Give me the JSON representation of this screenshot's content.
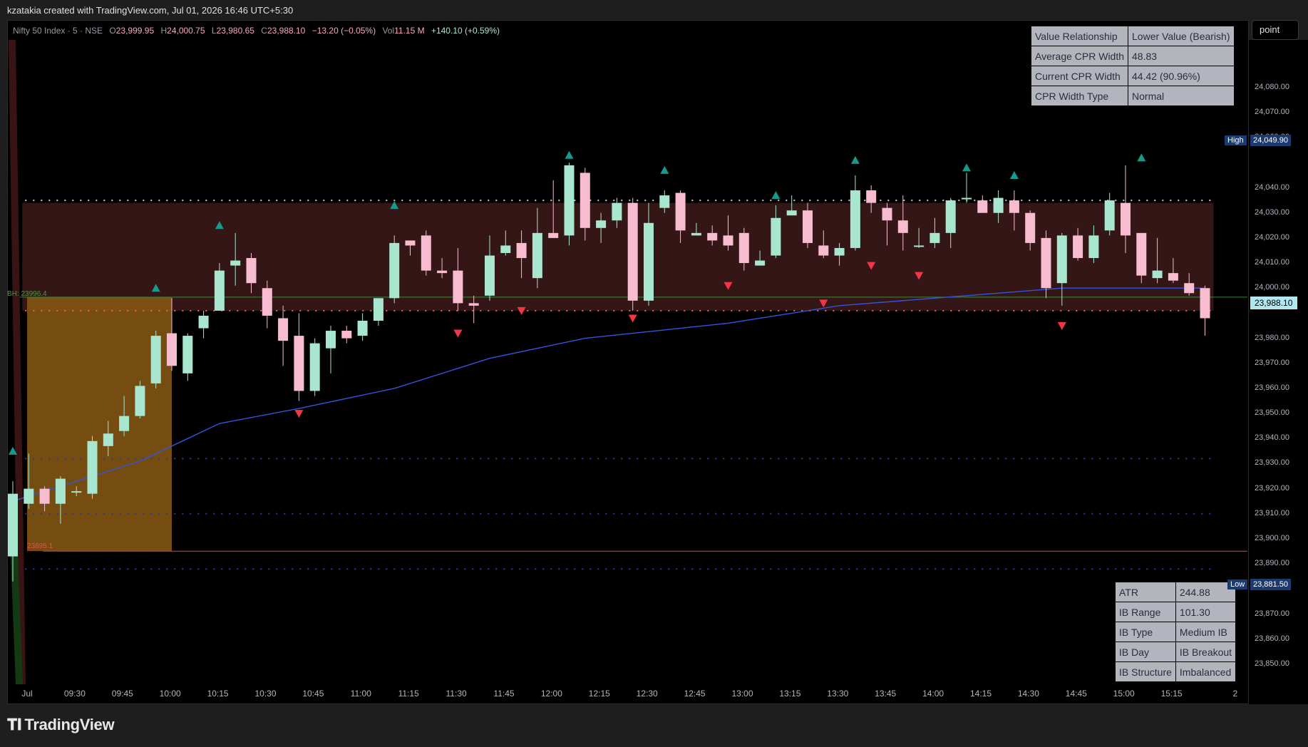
{
  "header": {
    "credit": "kzatakia created with TradingView.com, Jul 01, 2026 16:46 UTC+5:30"
  },
  "legend": {
    "symbol": "Nifty 50 Index · 5 · NSE",
    "o_label": "O",
    "o_val": "23,999.95",
    "h_label": "H",
    "h_val": "24,000.75",
    "l_label": "L",
    "l_val": "23,980.65",
    "c_label": "C",
    "c_val": "23,988.10",
    "change": "−13.20 (−0.05%)",
    "vol_label": "Vol",
    "vol_val": "11.15 M",
    "ext": "+140.10 (+0.59%)"
  },
  "toolbar": {
    "point_label": "point"
  },
  "cpr_table": [
    [
      "Value Relationship",
      "Lower Value (Bearish)"
    ],
    [
      "Average CPR Width",
      "48.83"
    ],
    [
      "Current CPR Width",
      "44.42 (90.96%)"
    ],
    [
      "CPR Width Type",
      "Normal"
    ]
  ],
  "ib_table": [
    [
      "ATR",
      "244.88"
    ],
    [
      "IB Range",
      "101.30"
    ],
    [
      "IB Type",
      "Medium IB"
    ],
    [
      "IB Day",
      "IB Breakout"
    ],
    [
      "IB Structure",
      "Imbalanced"
    ]
  ],
  "price_axis": {
    "ticks": [
      "24,080.00",
      "24,070.00",
      "24,060.00",
      "24,040.00",
      "24,030.00",
      "24,020.00",
      "24,010.00",
      "24,000.00",
      "23,980.00",
      "23,970.00",
      "23,960.00",
      "23,950.00",
      "23,940.00",
      "23,930.00",
      "23,920.00",
      "23,910.00",
      "23,900.00",
      "23,890.00",
      "23,870.00",
      "23,860.00",
      "23,850.00"
    ],
    "tick_values": [
      24080,
      24070,
      24060,
      24040,
      24030,
      24020,
      24010,
      24000,
      23980,
      23970,
      23960,
      23950,
      23940,
      23930,
      23920,
      23910,
      23900,
      23890,
      23870,
      23860,
      23850
    ],
    "high_label": "High",
    "high_value": "24,049.90",
    "low_label": "Low",
    "low_value": "23,881.50",
    "current_price": "23,988.10",
    "bh_label": "BH: 23996.4",
    "ib_low_label": "23895.1"
  },
  "time_axis": {
    "labels": [
      "Jul",
      "09:30",
      "09:45",
      "10:00",
      "10:15",
      "10:30",
      "10:45",
      "11:00",
      "11:15",
      "11:30",
      "11:45",
      "12:00",
      "12:15",
      "12:30",
      "12:45",
      "13:00",
      "13:15",
      "13:30",
      "13:45",
      "14:00",
      "14:15",
      "14:30",
      "14:45",
      "15:00",
      "15:15",
      "2"
    ],
    "label_bar_index": [
      0,
      3,
      6,
      9,
      12,
      15,
      18,
      21,
      24,
      27,
      30,
      33,
      36,
      39,
      42,
      45,
      48,
      51,
      54,
      57,
      60,
      63,
      66,
      69,
      72,
      76
    ]
  },
  "footer": {
    "logo_text": "TradingView"
  },
  "colors": {
    "up": "#a8e6cf",
    "down": "#f7bcd0",
    "cpr_band": "#3a1818",
    "ib_box": "#8a5a14",
    "ma": "#3355dd",
    "signal_up": "#159a8c",
    "signal_down": "#f23645"
  },
  "chart_data": {
    "type": "candlestick",
    "title": "Nifty 50 Index · 5 · NSE",
    "ylim": [
      23842,
      24099
    ],
    "candles": [
      [
        23893,
        23918,
        23883,
        23923
      ],
      [
        23914,
        23920,
        23912,
        23934
      ],
      [
        23920,
        23914,
        23911,
        23921
      ],
      [
        23914,
        23924,
        23906,
        23925
      ],
      [
        23919,
        23919,
        23917,
        23921
      ],
      [
        23918,
        23939,
        23916,
        23941
      ],
      [
        23937,
        23942,
        23933,
        23947
      ],
      [
        23943,
        23949,
        23941,
        23957
      ],
      [
        23949,
        23961,
        23948,
        23963
      ],
      [
        23962,
        23981,
        23960,
        23983
      ],
      [
        23982,
        23969,
        23967,
        23996
      ],
      [
        23966,
        23981,
        23963,
        23982
      ],
      [
        23984,
        23989,
        23980,
        23991
      ],
      [
        23991,
        24007,
        23991,
        24010
      ],
      [
        24009,
        24011,
        24001,
        24022
      ],
      [
        24012,
        24002,
        23998,
        24014
      ],
      [
        24000,
        23989,
        23984,
        24003
      ],
      [
        23988,
        23979,
        23969,
        23993
      ],
      [
        23981,
        23959,
        23955,
        23990
      ],
      [
        23959,
        23978,
        23957,
        23980
      ],
      [
        23976,
        23983,
        23966,
        23985
      ],
      [
        23983,
        23980,
        23978,
        23985
      ],
      [
        23981,
        23987,
        23979,
        23990
      ],
      [
        23987,
        23996,
        23985,
        23996
      ],
      [
        23996,
        24018,
        23994,
        24021
      ],
      [
        24019,
        24017,
        24013,
        24019
      ],
      [
        24021,
        24007,
        24005,
        24023
      ],
      [
        24007,
        24006,
        24004,
        24012
      ],
      [
        24007,
        23994,
        23991,
        24016
      ],
      [
        23994,
        23993,
        23986,
        23997
      ],
      [
        23997,
        24013,
        23995,
        24021
      ],
      [
        24014,
        24017,
        24013,
        24023
      ],
      [
        24018,
        24012,
        24004,
        24023
      ],
      [
        24004,
        24022,
        24000,
        24032
      ],
      [
        24022,
        24020,
        24020,
        24043
      ],
      [
        24021,
        24049,
        24017,
        24050
      ],
      [
        24046,
        24024,
        24019,
        24048
      ],
      [
        24024,
        24027,
        24018,
        24030
      ],
      [
        24027,
        24034,
        24024,
        24036
      ],
      [
        24034,
        23995,
        23991,
        24036
      ],
      [
        23995,
        24026,
        23993,
        24034
      ],
      [
        24032,
        24037,
        24030,
        24039
      ],
      [
        24038,
        24023,
        24018,
        24039
      ],
      [
        24021,
        24022,
        24022,
        24026
      ],
      [
        24022,
        24019,
        24017,
        24025
      ],
      [
        24021,
        24017,
        24015,
        24029
      ],
      [
        24022,
        24010,
        24007,
        24024
      ],
      [
        24009,
        24011,
        24009,
        24015
      ],
      [
        24013,
        24028,
        24012,
        24033
      ],
      [
        24029,
        24031,
        24030,
        24037
      ],
      [
        24031,
        24018,
        24016,
        24034
      ],
      [
        24017,
        24013,
        24012,
        24023
      ],
      [
        24013,
        24016,
        24009,
        24018
      ],
      [
        24016,
        24039,
        24015,
        24045
      ],
      [
        24039,
        24034,
        24030,
        24041
      ],
      [
        24032,
        24027,
        24017,
        24034
      ],
      [
        24027,
        24022,
        24015,
        24037
      ],
      [
        24017,
        24017,
        24016,
        24024
      ],
      [
        24018,
        24022,
        24016,
        24028
      ],
      [
        24022,
        24035,
        24016,
        24036
      ],
      [
        24036,
        24036,
        24034,
        24046
      ],
      [
        24035,
        24030,
        24030,
        24037
      ],
      [
        24030,
        24036,
        24026,
        24039
      ],
      [
        24035,
        24030,
        24023,
        24039
      ],
      [
        24030,
        24018,
        24015,
        24031
      ],
      [
        24020,
        24000,
        23996,
        24023
      ],
      [
        24002,
        24021,
        23993,
        24022
      ],
      [
        24021,
        24012,
        24011,
        24024
      ],
      [
        24012,
        24021,
        24010,
        24025
      ],
      [
        24023,
        24035,
        24021,
        24038
      ],
      [
        24034,
        24021,
        24014,
        24049
      ],
      [
        24022,
        24005,
        24002,
        24022
      ],
      [
        24004,
        24007,
        24002,
        24020
      ],
      [
        24006,
        24003,
        24002,
        24012
      ],
      [
        24002,
        23998,
        23997,
        24006
      ],
      [
        24000,
        23988,
        23981,
        24001
      ]
    ],
    "cpr_band": [
      23991,
      24034
    ],
    "ib_box": {
      "from_bar": 0,
      "to_bar": 9,
      "high": 23996.4,
      "low": 23895.1
    },
    "ma_anchor_points": [
      [
        0,
        23915
      ],
      [
        8,
        23931
      ],
      [
        13,
        23946
      ],
      [
        18,
        23952
      ],
      [
        24,
        23960
      ],
      [
        30,
        23972
      ],
      [
        36,
        23980
      ],
      [
        45,
        23986
      ],
      [
        52,
        23993
      ],
      [
        60,
        23997
      ],
      [
        66,
        24000
      ],
      [
        75,
        24000
      ]
    ],
    "signals_up": [
      [
        0,
        23935
      ],
      [
        9,
        24000
      ],
      [
        13,
        24025
      ],
      [
        24,
        24033
      ],
      [
        35,
        24053
      ],
      [
        41,
        24047
      ],
      [
        48,
        24037
      ],
      [
        53,
        24051
      ],
      [
        60,
        24048
      ],
      [
        63,
        24045
      ],
      [
        71,
        24052
      ]
    ],
    "signals_down": [
      [
        18,
        23950
      ],
      [
        28,
        23982
      ],
      [
        32,
        23991
      ],
      [
        39,
        23988
      ],
      [
        45,
        24001
      ],
      [
        51,
        23994
      ],
      [
        54,
        24009
      ],
      [
        57,
        24005
      ],
      [
        66,
        23985
      ]
    ],
    "hlines": {
      "ib_low_red": 23895.1,
      "bh_green": 23996.4,
      "dots_high": 24035,
      "dots_low": 23991,
      "dots_blue_1": 23932,
      "dots_blue_2": 23910,
      "dots_blue_3": 23888
    }
  }
}
